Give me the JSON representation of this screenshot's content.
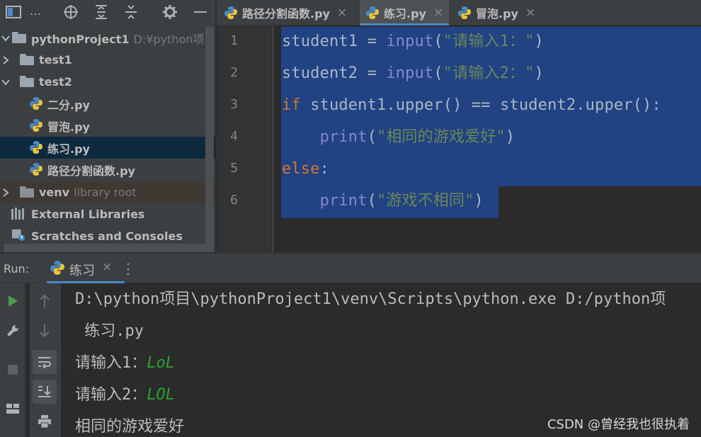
{
  "project": {
    "toolbar_title": "…",
    "tree": [
      {
        "label": "pythonProject1",
        "hint": "D:¥python项目¥py",
        "icon": "folder-icon",
        "expanded": true
      },
      {
        "label": "test1",
        "hint": "",
        "icon": "folder-icon",
        "expanded": false
      },
      {
        "label": "test2",
        "hint": "",
        "icon": "folder-icon",
        "expanded": true
      },
      {
        "label": "二分.py",
        "hint": "",
        "icon": "python-file-icon"
      },
      {
        "label": "冒泡.py",
        "hint": "",
        "icon": "python-file-icon"
      },
      {
        "label": "练习.py",
        "hint": "",
        "icon": "python-file-icon",
        "selected": true
      },
      {
        "label": "路径分割函数.py",
        "hint": "",
        "icon": "python-file-icon"
      },
      {
        "label": "venv",
        "hint": "library root",
        "icon": "folder-icon",
        "expanded": false
      },
      {
        "label": "External Libraries",
        "hint": "",
        "icon": "libraries-icon"
      },
      {
        "label": "Scratches and Consoles",
        "hint": "",
        "icon": "scratches-icon"
      }
    ]
  },
  "editor": {
    "tabs": [
      {
        "label": "路径分割函数.py",
        "close": "×",
        "active": false
      },
      {
        "label": "练习.py",
        "close": "×",
        "active": true
      },
      {
        "label": "冒泡.py",
        "close": "×",
        "active": false
      }
    ],
    "line_numbers": [
      "1",
      "2",
      "3",
      "4",
      "5",
      "6"
    ],
    "code": [
      [
        {
          "t": "student1 = ",
          "c": ""
        },
        {
          "t": "input",
          "c": "bi"
        },
        {
          "t": "(",
          "c": ""
        },
        {
          "t": "\"请输入1：\"",
          "c": "str"
        },
        {
          "t": ")",
          "c": ""
        }
      ],
      [
        {
          "t": "student2 = ",
          "c": ""
        },
        {
          "t": "input",
          "c": "bi"
        },
        {
          "t": "(",
          "c": ""
        },
        {
          "t": "\"请输入2：\"",
          "c": "str"
        },
        {
          "t": ")",
          "c": ""
        }
      ],
      [
        {
          "t": "if",
          "c": "kw"
        },
        {
          "t": " student1.upper() == student2.upper():",
          "c": ""
        }
      ],
      [
        {
          "t": "    ",
          "c": ""
        },
        {
          "t": "print",
          "c": "bi"
        },
        {
          "t": "(",
          "c": ""
        },
        {
          "t": "\"相同的游戏爱好\"",
          "c": "str"
        },
        {
          "t": ")",
          "c": ""
        }
      ],
      [
        {
          "t": "else",
          "c": "kw"
        },
        {
          "t": ":",
          "c": ""
        }
      ],
      [
        {
          "t": "    ",
          "c": ""
        },
        {
          "t": "print",
          "c": "bi"
        },
        {
          "t": "(",
          "c": ""
        },
        {
          "t": "\"游戏不相同\"",
          "c": "str"
        },
        {
          "t": ")",
          "c": ""
        }
      ]
    ]
  },
  "run": {
    "label": "Run:",
    "tab_label": "练习",
    "tab_close": "×",
    "console": [
      {
        "text": "D:\\python项目\\pythonProject1\\venv\\Scripts\\python.exe D:/python项",
        "input": ""
      },
      {
        "text": " 练习.py",
        "input": ""
      },
      {
        "text": "请输入1：",
        "input": "LoL"
      },
      {
        "text": "请输入2：",
        "input": "LOL"
      },
      {
        "text": "相同的游戏爱好",
        "input": ""
      }
    ]
  },
  "watermark": "CSDN @曾经我也很执着",
  "colors": {
    "keyword": "#cc7832",
    "builtin": "#8888c6",
    "string": "#6a8759",
    "selection": "#214283",
    "user_input": "#29a329",
    "accent": "#4a88c7"
  }
}
